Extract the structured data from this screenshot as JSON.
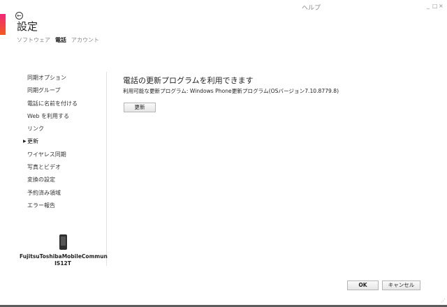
{
  "window": {
    "help_label": "ヘルプ",
    "minimize_glyph": "_",
    "maximize_glyph": "□",
    "close_glyph": "×"
  },
  "header": {
    "back_glyph": "←",
    "title": "設定",
    "tabs": [
      {
        "label": "ソフトウェア",
        "active": false
      },
      {
        "label": "電話",
        "active": true
      },
      {
        "label": "アカウント",
        "active": false
      }
    ]
  },
  "sidebar": {
    "items": [
      {
        "label": "同期オプション"
      },
      {
        "label": "同期グループ"
      },
      {
        "label": "電話に名前を付ける"
      },
      {
        "label": "Web を利用する"
      },
      {
        "label": "リンク"
      },
      {
        "label": "更新",
        "selected": true
      },
      {
        "label": "ワイヤレス同期"
      },
      {
        "label": "写真とビデオ"
      },
      {
        "label": "変換の設定"
      },
      {
        "label": "予約済み領域"
      },
      {
        "label": "エラー報告"
      }
    ],
    "selected_marker": "▶"
  },
  "device": {
    "icon": "phone-icon",
    "name": "FujitsuToshibaMobileCommun IS12T"
  },
  "main": {
    "heading": "電話の更新プログラムを利用できます",
    "subtext": "利用可能な更新プログラム: Windows Phone更新プログラム(OSバージョン7.10.8779.8)",
    "update_button": "更新"
  },
  "footer": {
    "ok": "OK",
    "cancel": "キャンセル",
    "grip": "⋰"
  },
  "colors": {
    "accent_top": "#f0287a",
    "accent_bottom": "#f25a1f",
    "muted_text": "#8a8a8a"
  }
}
